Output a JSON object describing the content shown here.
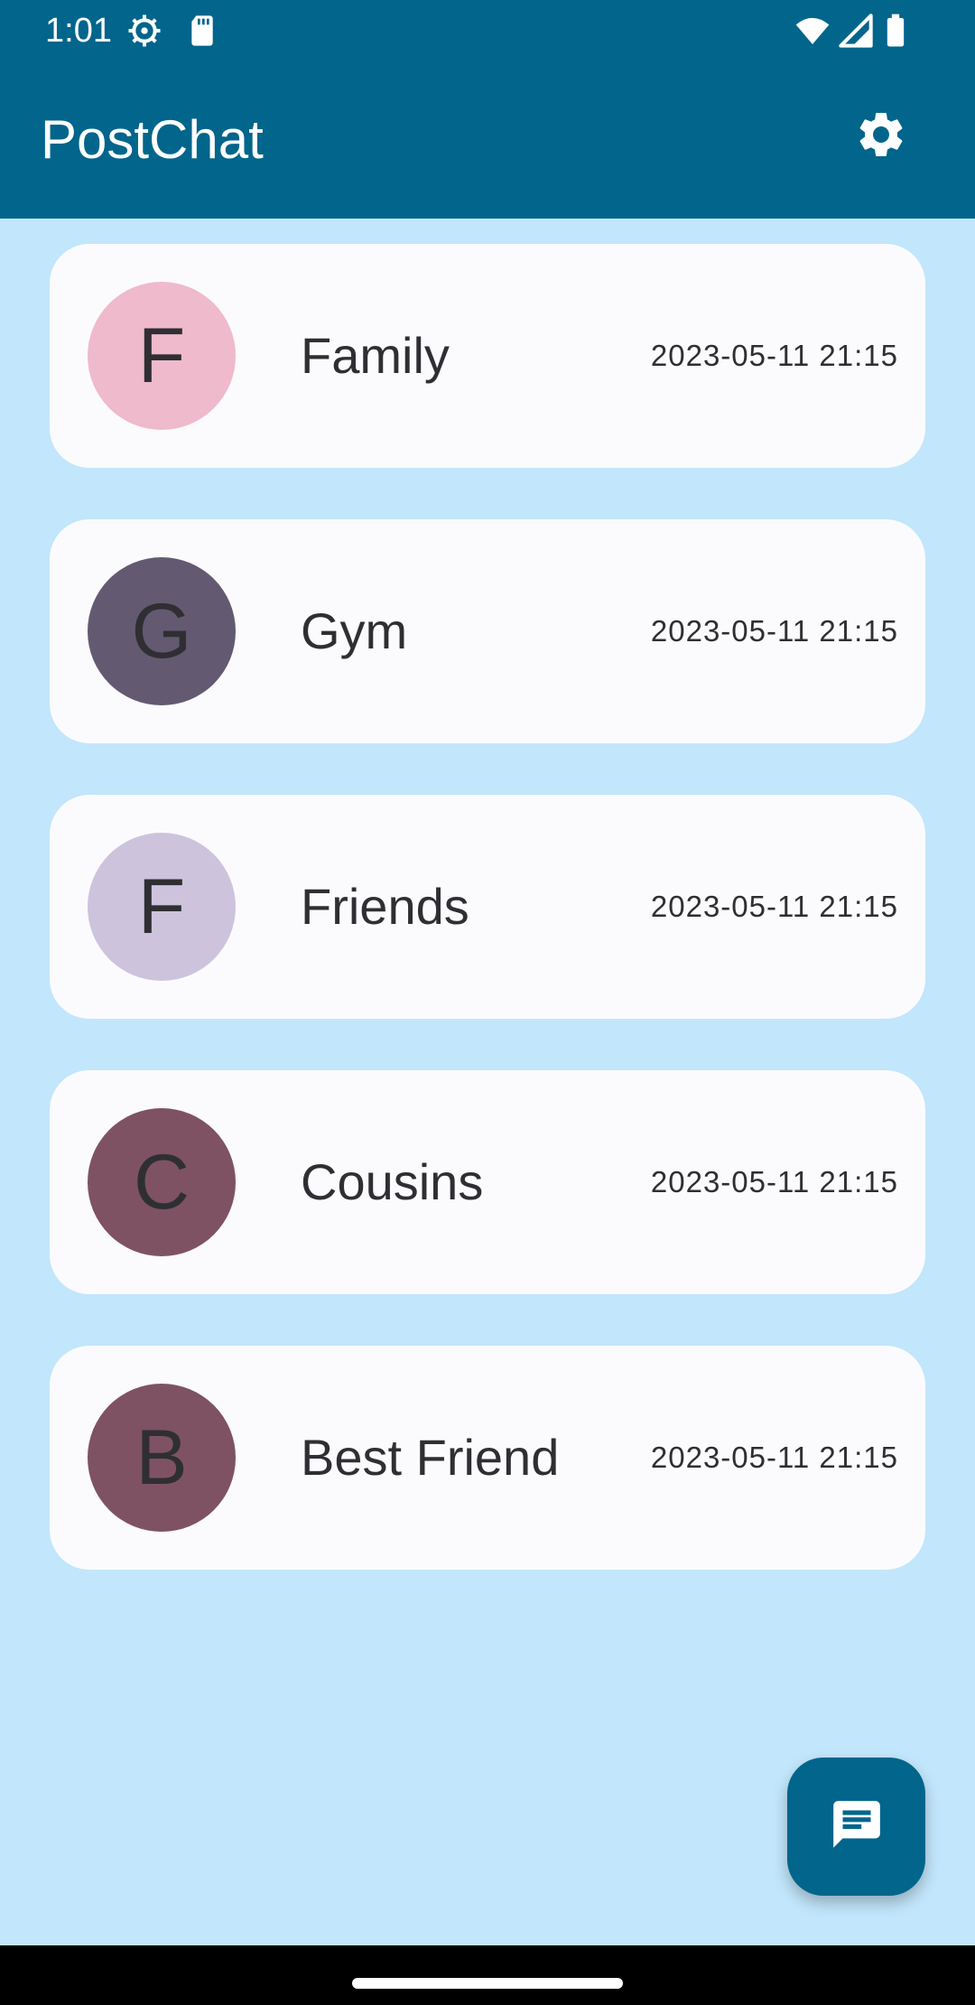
{
  "status_bar": {
    "time": "1:01",
    "left_icons": [
      "settings-gear-icon",
      "sd-card-icon"
    ],
    "right_icons": [
      "wifi-icon",
      "signal-icon",
      "battery-icon"
    ]
  },
  "app_bar": {
    "title": "PostChat",
    "settings_icon": "gear-icon"
  },
  "chats": [
    {
      "initial": "F",
      "name": "Family",
      "time": "2023-05-11 21:15",
      "avatar_color": "#efbacb"
    },
    {
      "initial": "G",
      "name": "Gym",
      "time": "2023-05-11 21:15",
      "avatar_color": "#635a72"
    },
    {
      "initial": "F",
      "name": "Friends",
      "time": "2023-05-11 21:15",
      "avatar_color": "#cdc3dd"
    },
    {
      "initial": "C",
      "name": "Cousins",
      "time": "2023-05-11 21:15",
      "avatar_color": "#7e5262"
    },
    {
      "initial": "B",
      "name": "Best Friend",
      "time": "2023-05-11 21:15",
      "avatar_color": "#7e5262"
    }
  ],
  "fab": {
    "icon": "chat-icon"
  },
  "colors": {
    "primary": "#01658c",
    "background": "#c2e6fb",
    "card": "#fbfbfe",
    "text": "#2f2f33"
  }
}
